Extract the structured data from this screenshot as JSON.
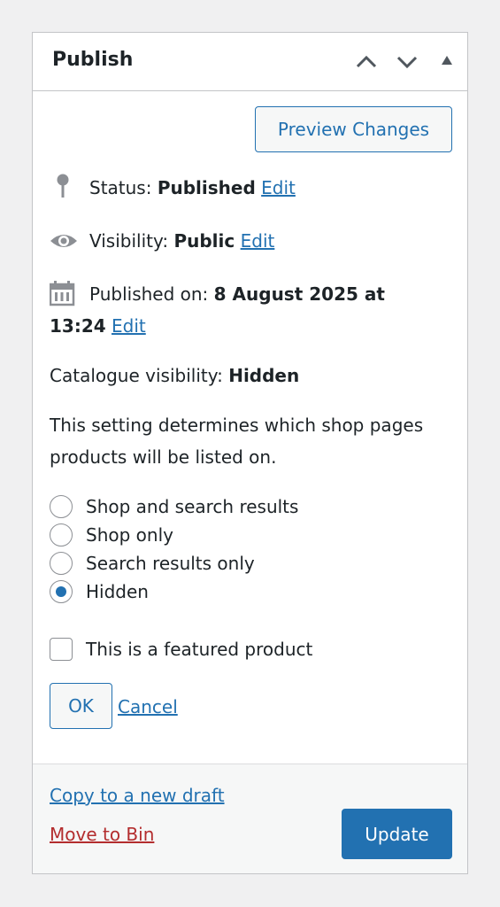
{
  "header": {
    "title": "Publish"
  },
  "actions": {
    "preview_label": "Preview Changes"
  },
  "status": {
    "label": "Status:",
    "value": "Published",
    "edit": "Edit"
  },
  "visibility": {
    "label": "Visibility:",
    "value": "Public",
    "edit": "Edit"
  },
  "published_on": {
    "label": "Published on:",
    "date": "8 August 2025 at",
    "time": "13:24",
    "edit": "Edit"
  },
  "catalogue": {
    "label": "Catalogue visibility:",
    "value": "Hidden",
    "description_line1": "This setting determines which shop pages",
    "description_line2": "products will be listed on.",
    "options": [
      {
        "label": "Shop and search results",
        "checked": false
      },
      {
        "label": "Shop only",
        "checked": false
      },
      {
        "label": "Search results only",
        "checked": false
      },
      {
        "label": "Hidden",
        "checked": true
      }
    ],
    "featured_label": "This is a featured product",
    "ok_label": "OK",
    "cancel_label": "Cancel"
  },
  "footer": {
    "copy_draft": "Copy to a new draft",
    "move_to_bin": "Move to Bin",
    "update_label": "Update"
  },
  "colors": {
    "accent": "#2271b1",
    "danger": "#b32d2e",
    "icon": "#8c8f94"
  },
  "icons": [
    "chevron-up-icon",
    "chevron-down-icon",
    "triangle-up-icon",
    "pin-icon",
    "eye-icon",
    "calendar-icon"
  ]
}
